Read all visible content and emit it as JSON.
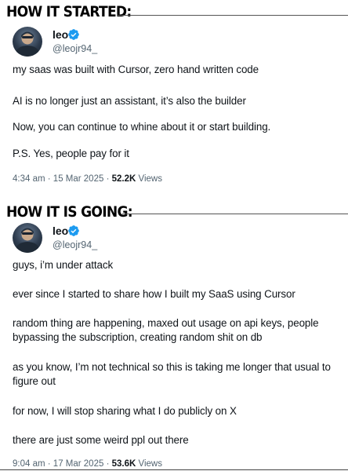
{
  "headings": {
    "started": "HOW IT STARTED:",
    "going": "HOW IT IS GOING:"
  },
  "tweet1": {
    "author_name": "leo",
    "handle": "@leojr94_",
    "verified_icon": "verified-badge-icon",
    "lines": [
      "my saas was built with Cursor, zero hand written code",
      "AI is no longer just an assistant, it’s also the builder",
      "Now, you can continue to whine about it or start building.",
      "P.S. Yes, people pay for it"
    ],
    "time": "4:34 am",
    "date": "15 Mar 2025",
    "views_count": "52.2K",
    "views_label": "Views"
  },
  "tweet2": {
    "author_name": "leo",
    "handle": "@leojr94_",
    "verified_icon": "verified-badge-icon",
    "lines": [
      "guys, i’m under attack",
      "ever since I started to share how I built my SaaS using Cursor",
      "random thing are happening, maxed out usage on api keys, people",
      "bypassing the subscription, creating random shit on db",
      "as you know, I’m not technical so this is taking me longer that usual to",
      "figure out",
      "for now, I will stop sharing what I do publicly on X",
      "there are just some weird ppl out there"
    ],
    "time": "9:04 am",
    "date": "17 Mar 2025",
    "views_count": "53.6K",
    "views_label": "Views"
  },
  "colors": {
    "text": "#0f1419",
    "muted": "#536471",
    "verified": "#1d9bf0"
  }
}
